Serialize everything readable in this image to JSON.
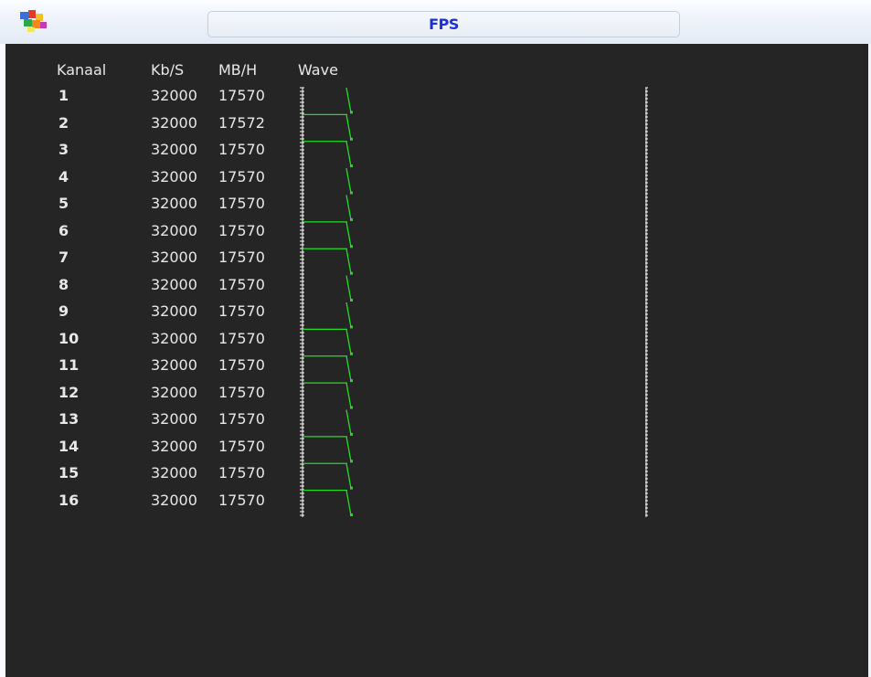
{
  "window": {
    "title": "FPS",
    "icon": "app-logo-icon"
  },
  "table": {
    "headers": {
      "channel": "Kanaal",
      "kbps": "Kb/S",
      "mbh": "MB/H",
      "wave": "Wave"
    },
    "rows": [
      {
        "channel": "1",
        "kbps": "32000",
        "mbh": "17570",
        "marker": true
      },
      {
        "channel": "2",
        "kbps": "32000",
        "mbh": "17572",
        "marker": true
      },
      {
        "channel": "3",
        "kbps": "32000",
        "mbh": "17570",
        "marker": false
      },
      {
        "channel": "4",
        "kbps": "32000",
        "mbh": "17570",
        "marker": false
      },
      {
        "channel": "5",
        "kbps": "32000",
        "mbh": "17570",
        "marker": true
      },
      {
        "channel": "6",
        "kbps": "32000",
        "mbh": "17570",
        "marker": true
      },
      {
        "channel": "7",
        "kbps": "32000",
        "mbh": "17570",
        "marker": false
      },
      {
        "channel": "8",
        "kbps": "32000",
        "mbh": "17570",
        "marker": false
      },
      {
        "channel": "9",
        "kbps": "32000",
        "mbh": "17570",
        "marker": true
      },
      {
        "channel": "10",
        "kbps": "32000",
        "mbh": "17570",
        "marker": true
      },
      {
        "channel": "11",
        "kbps": "32000",
        "mbh": "17570",
        "marker": true
      },
      {
        "channel": "12",
        "kbps": "32000",
        "mbh": "17570",
        "marker": false
      },
      {
        "channel": "13",
        "kbps": "32000",
        "mbh": "17570",
        "marker": true
      },
      {
        "channel": "14",
        "kbps": "32000",
        "mbh": "17570",
        "marker": true
      },
      {
        "channel": "15",
        "kbps": "32000",
        "mbh": "17570",
        "marker": true
      },
      {
        "channel": "16",
        "kbps": "32000",
        "mbh": "17570",
        "marker": false
      }
    ]
  },
  "colors": {
    "background": "#252525",
    "text": "#e8e8e8",
    "wave": "#22dd22",
    "title": "#1e2fd6"
  }
}
